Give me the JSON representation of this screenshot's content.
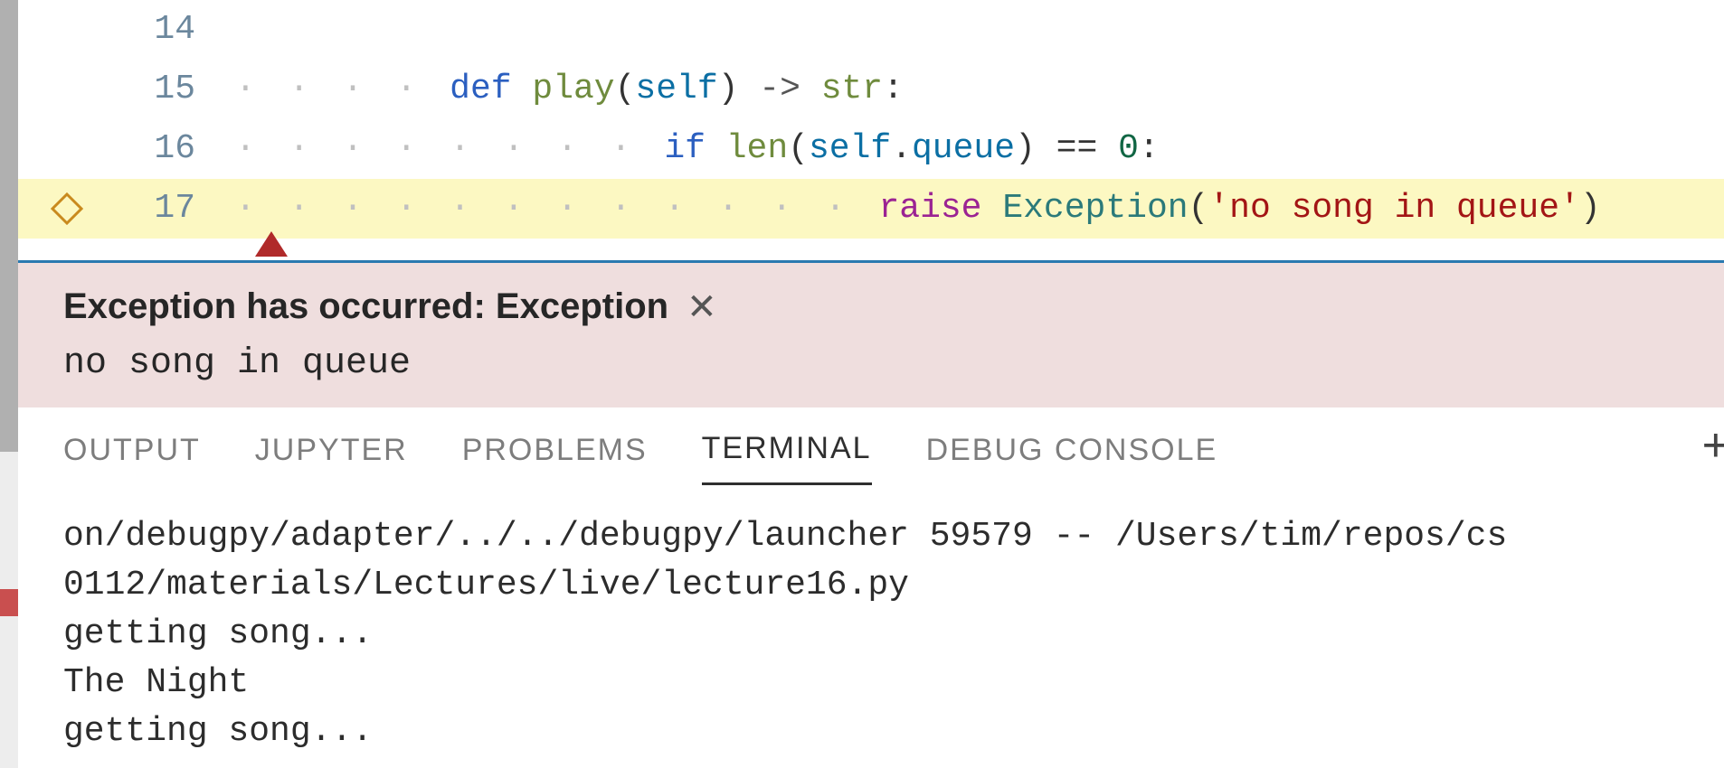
{
  "code": {
    "lines": [
      {
        "n": "14"
      },
      {
        "n": "15"
      },
      {
        "n": "16"
      },
      {
        "n": "17"
      }
    ],
    "tokens": {
      "def": "def",
      "play": "play",
      "self": "self",
      "arrow": "->",
      "str_type": "str",
      "colon": ":",
      "if": "if",
      "len": "len",
      "dot": ".",
      "queue": "queue",
      "eqeq": "==",
      "zero": "0",
      "raise": "raise",
      "exception": "Exception",
      "msg": "'no song in queue'",
      "lp": "(",
      "rp": ")"
    }
  },
  "exception": {
    "title": "Exception has occurred: Exception",
    "message": "no song in queue"
  },
  "tabs": {
    "output": "OUTPUT",
    "jupyter": "JUPYTER",
    "problems": "PROBLEMS",
    "terminal": "TERMINAL",
    "debug": "DEBUG CONSOLE"
  },
  "terminal": {
    "l1": "on/debugpy/adapter/../../debugpy/launcher 59579 -- /Users/tim/repos/cs",
    "l2": "0112/materials/Lectures/live/lecture16.py",
    "l3": "getting song...",
    "l4": "The Night",
    "l5": "getting song..."
  }
}
